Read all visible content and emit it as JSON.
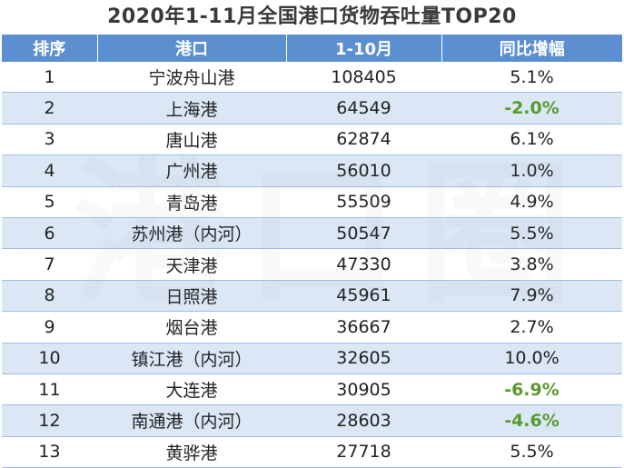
{
  "title": "2020年1-11月全国港口货物吞吐量TOP20",
  "colors": {
    "header_bg": "#5b8fd0",
    "stripe_bg": "#dbe7f5",
    "negative": "#5a9a2c"
  },
  "headers": {
    "rank": "排序",
    "port": "港口",
    "value": "1-10月",
    "yoy": "同比增幅"
  },
  "rows": [
    {
      "rank": "1",
      "port": "宁波舟山港",
      "value": "108405",
      "yoy": "5.1%",
      "negative": false
    },
    {
      "rank": "2",
      "port": "上海港",
      "value": "64549",
      "yoy": "-2.0%",
      "negative": true
    },
    {
      "rank": "3",
      "port": "唐山港",
      "value": "62874",
      "yoy": "6.1%",
      "negative": false
    },
    {
      "rank": "4",
      "port": "广州港",
      "value": "56010",
      "yoy": "1.0%",
      "negative": false
    },
    {
      "rank": "5",
      "port": "青岛港",
      "value": "55509",
      "yoy": "4.9%",
      "negative": false
    },
    {
      "rank": "6",
      "port": "苏州港（内河）",
      "value": "50547",
      "yoy": "5.5%",
      "negative": false
    },
    {
      "rank": "7",
      "port": "天津港",
      "value": "47330",
      "yoy": "3.8%",
      "negative": false
    },
    {
      "rank": "8",
      "port": "日照港",
      "value": "45961",
      "yoy": "7.9%",
      "negative": false
    },
    {
      "rank": "9",
      "port": "烟台港",
      "value": "36667",
      "yoy": "2.7%",
      "negative": false
    },
    {
      "rank": "10",
      "port": "镇江港（内河）",
      "value": "32605",
      "yoy": "10.0%",
      "negative": false
    },
    {
      "rank": "11",
      "port": "大连港",
      "value": "30905",
      "yoy": "-6.9%",
      "negative": true
    },
    {
      "rank": "12",
      "port": "南通港（内河）",
      "value": "28603",
      "yoy": "-4.6%",
      "negative": true
    },
    {
      "rank": "13",
      "port": "黄骅港",
      "value": "27718",
      "yoy": "5.5%",
      "negative": false
    }
  ]
}
